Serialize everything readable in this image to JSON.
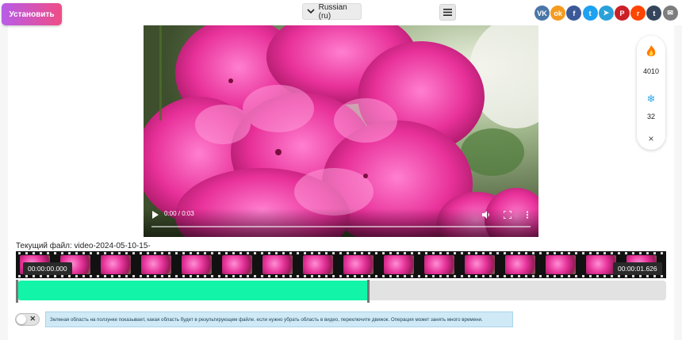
{
  "header": {
    "install_label": "Установить",
    "language": "Russian (ru)"
  },
  "share_icons": [
    {
      "name": "vk",
      "glyph": "VK",
      "color": "#4a76a8"
    },
    {
      "name": "odnoklassniki",
      "glyph": "ok",
      "color": "#f59b22"
    },
    {
      "name": "facebook",
      "glyph": "f",
      "color": "#3b5998"
    },
    {
      "name": "twitter",
      "glyph": "t",
      "color": "#1da1f2"
    },
    {
      "name": "telegram",
      "glyph": "➤",
      "color": "#2aa1da"
    },
    {
      "name": "pinterest",
      "glyph": "P",
      "color": "#cb2027"
    },
    {
      "name": "reddit",
      "glyph": "r",
      "color": "#ff4500"
    },
    {
      "name": "tumblr",
      "glyph": "t",
      "color": "#35465c"
    },
    {
      "name": "email",
      "glyph": "✉",
      "color": "#7d7d7d"
    }
  ],
  "player": {
    "time": "0:00 / 0:03",
    "progress": 0
  },
  "stats_panel": {
    "fire_count": "4010",
    "snow_count": "32",
    "close_glyph": "×"
  },
  "editor": {
    "current_file": "Текущий файл: video-2024-05-10-15-",
    "start_time": "00:00:00.000",
    "end_time": "00:00:01.626",
    "selection_fraction": 0.54,
    "selection_color": "#12f5a8",
    "hint": "Зеленая область на ползунке показывает, какая область будет в результирующем файле. если нужно убрать область в видео, переключите движок. Операция может занять много времени."
  }
}
